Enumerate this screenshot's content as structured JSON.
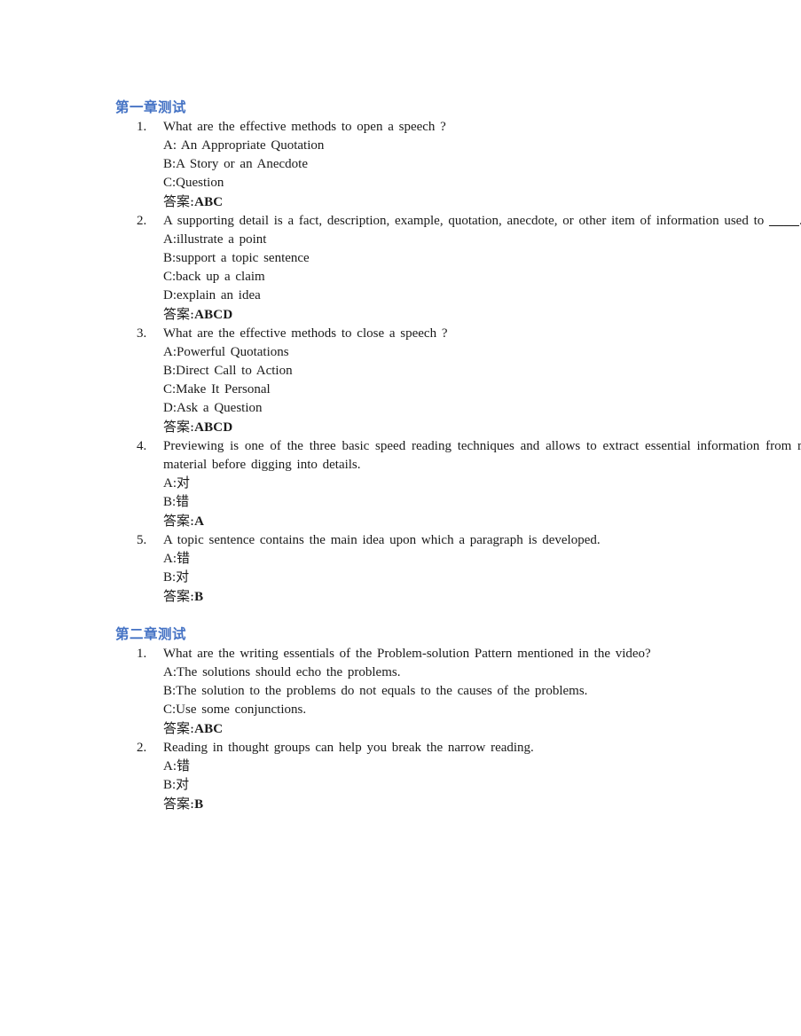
{
  "document": {
    "heading_color": "#4472C4",
    "body_color": "#1a1a1a",
    "answer_label": "答案:"
  },
  "chapters": [
    {
      "title": "第一章测试",
      "questions": [
        {
          "number": "1.",
          "stem": "What are the effective methods to open a speech ?",
          "options": [
            "A: An Appropriate Quotation",
            "B:A Story or an Anecdote",
            "C:Question"
          ],
          "answer_label": "答案:",
          "answer_value": "ABC"
        },
        {
          "number": "2.",
          "stem_before_blank": "A supporting detail is a fact, description, example, quotation, anecdote, or other item of information used to ",
          "stem_blank": "____",
          "stem_after_blank": ".",
          "options": [
            "A:illustrate a point",
            "B:support a topic sentence",
            "C:back up a claim",
            "D:explain an idea"
          ],
          "answer_label": "答案:",
          "answer_value": "ABCD"
        },
        {
          "number": "3.",
          "stem": "What are the effective methods to close a speech ?",
          "options": [
            "A:Powerful Quotations",
            "B:Direct Call to Action",
            "C:Make It Personal",
            "D:Ask a Question"
          ],
          "answer_label": "答案:",
          "answer_value": "ABCD"
        },
        {
          "number": "4.",
          "stem": "Previewing is one of the three basic speed reading techniques and allows to extract essential information from reading material before digging into details.",
          "options": [
            "A:对",
            "B:错"
          ],
          "answer_label": "答案:",
          "answer_value": "A"
        },
        {
          "number": "5.",
          "stem": "A topic sentence contains the main idea upon which a paragraph is developed.",
          "options": [
            "A:错",
            "B:对"
          ],
          "answer_label": "答案:",
          "answer_value": "B"
        }
      ]
    },
    {
      "title": "第二章测试",
      "questions": [
        {
          "number": "1.",
          "stem": "What are the writing essentials of the Problem-solution Pattern mentioned in the video?",
          "options": [
            "A:The solutions should echo the problems.",
            "B:The solution to the problems do not equals to the causes of the problems.",
            "C:Use some conjunctions."
          ],
          "answer_label": "答案:",
          "answer_value": "ABC"
        },
        {
          "number": "2.",
          "stem": "Reading in thought groups can help you break the narrow reading.",
          "options": [
            "A:错",
            "B:对"
          ],
          "answer_label": "答案:",
          "answer_value": "B"
        }
      ]
    }
  ]
}
